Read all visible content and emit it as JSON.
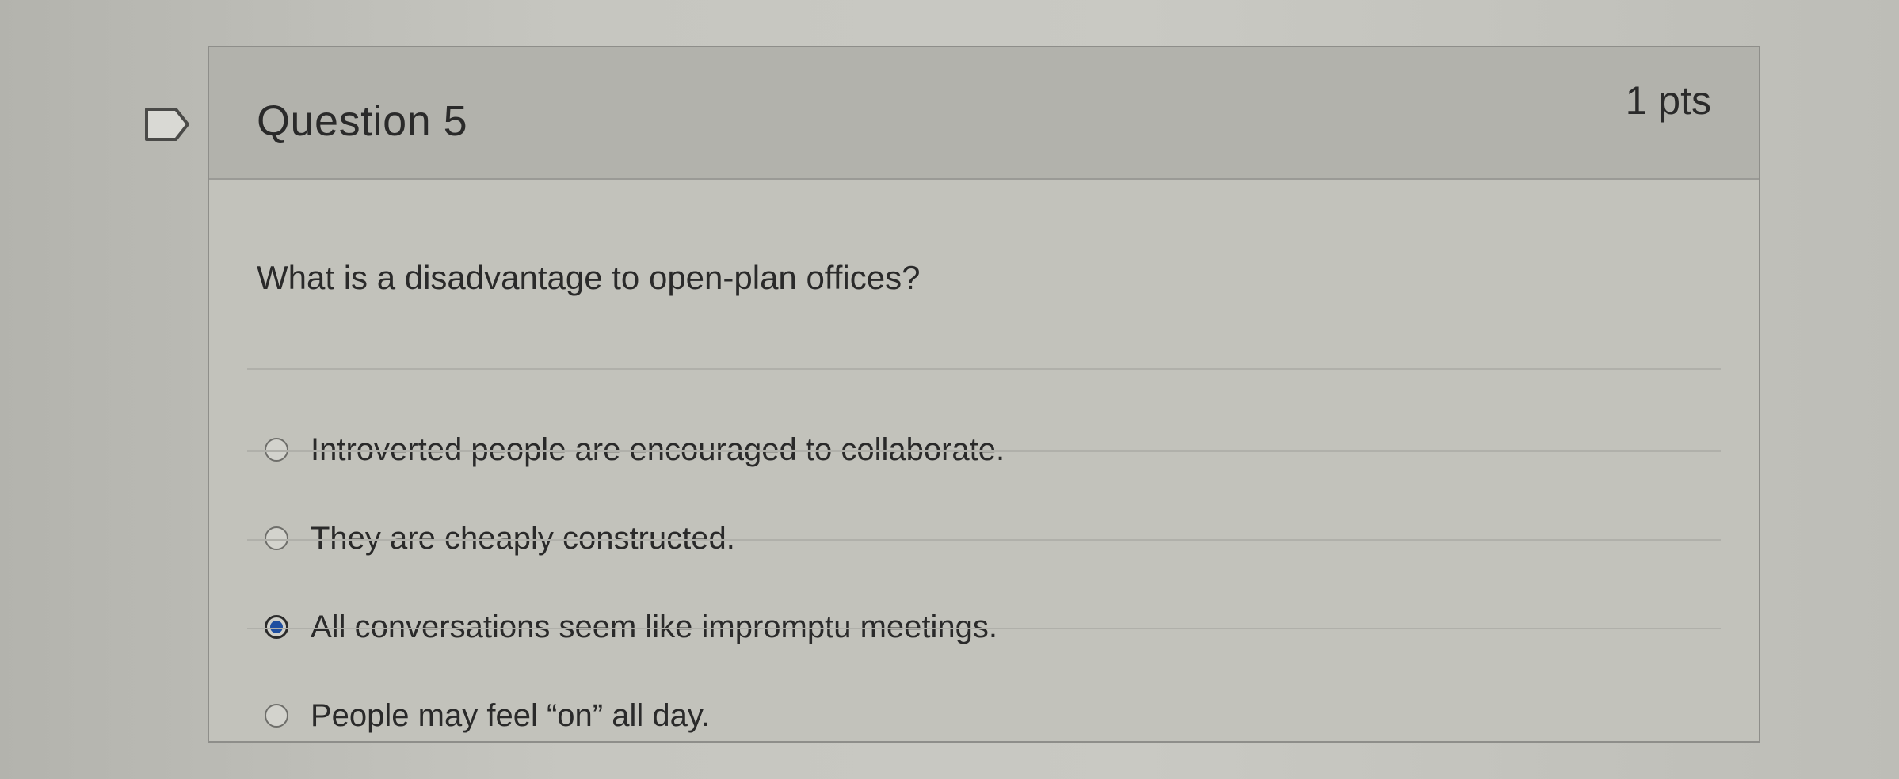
{
  "question": {
    "title": "Question 5",
    "points": "1 pts",
    "text": "What is a disadvantage to open-plan offices?",
    "answers": [
      {
        "label": "Introverted people are encouraged to collaborate.",
        "selected": false
      },
      {
        "label": "They are cheaply constructed.",
        "selected": false
      },
      {
        "label": "All conversations seem like impromptu meetings.",
        "selected": true
      },
      {
        "label": "People may feel “on” all day.",
        "selected": false
      }
    ]
  },
  "icons": {
    "flag": "flag-question-icon"
  },
  "colors": {
    "selected_radio": "#1f4fa0"
  }
}
